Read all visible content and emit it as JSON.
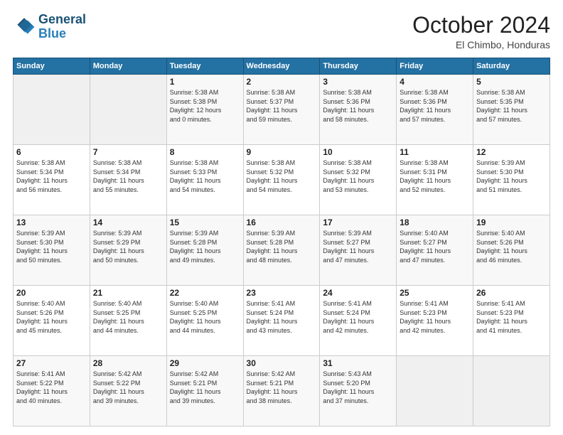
{
  "logo": {
    "line1": "General",
    "line2": "Blue"
  },
  "title": "October 2024",
  "subtitle": "El Chimbo, Honduras",
  "days_header": [
    "Sunday",
    "Monday",
    "Tuesday",
    "Wednesday",
    "Thursday",
    "Friday",
    "Saturday"
  ],
  "weeks": [
    [
      {
        "num": "",
        "info": ""
      },
      {
        "num": "",
        "info": ""
      },
      {
        "num": "1",
        "info": "Sunrise: 5:38 AM\nSunset: 5:38 PM\nDaylight: 12 hours\nand 0 minutes."
      },
      {
        "num": "2",
        "info": "Sunrise: 5:38 AM\nSunset: 5:37 PM\nDaylight: 11 hours\nand 59 minutes."
      },
      {
        "num": "3",
        "info": "Sunrise: 5:38 AM\nSunset: 5:36 PM\nDaylight: 11 hours\nand 58 minutes."
      },
      {
        "num": "4",
        "info": "Sunrise: 5:38 AM\nSunset: 5:36 PM\nDaylight: 11 hours\nand 57 minutes."
      },
      {
        "num": "5",
        "info": "Sunrise: 5:38 AM\nSunset: 5:35 PM\nDaylight: 11 hours\nand 57 minutes."
      }
    ],
    [
      {
        "num": "6",
        "info": "Sunrise: 5:38 AM\nSunset: 5:34 PM\nDaylight: 11 hours\nand 56 minutes."
      },
      {
        "num": "7",
        "info": "Sunrise: 5:38 AM\nSunset: 5:34 PM\nDaylight: 11 hours\nand 55 minutes."
      },
      {
        "num": "8",
        "info": "Sunrise: 5:38 AM\nSunset: 5:33 PM\nDaylight: 11 hours\nand 54 minutes."
      },
      {
        "num": "9",
        "info": "Sunrise: 5:38 AM\nSunset: 5:32 PM\nDaylight: 11 hours\nand 54 minutes."
      },
      {
        "num": "10",
        "info": "Sunrise: 5:38 AM\nSunset: 5:32 PM\nDaylight: 11 hours\nand 53 minutes."
      },
      {
        "num": "11",
        "info": "Sunrise: 5:38 AM\nSunset: 5:31 PM\nDaylight: 11 hours\nand 52 minutes."
      },
      {
        "num": "12",
        "info": "Sunrise: 5:39 AM\nSunset: 5:30 PM\nDaylight: 11 hours\nand 51 minutes."
      }
    ],
    [
      {
        "num": "13",
        "info": "Sunrise: 5:39 AM\nSunset: 5:30 PM\nDaylight: 11 hours\nand 50 minutes."
      },
      {
        "num": "14",
        "info": "Sunrise: 5:39 AM\nSunset: 5:29 PM\nDaylight: 11 hours\nand 50 minutes."
      },
      {
        "num": "15",
        "info": "Sunrise: 5:39 AM\nSunset: 5:28 PM\nDaylight: 11 hours\nand 49 minutes."
      },
      {
        "num": "16",
        "info": "Sunrise: 5:39 AM\nSunset: 5:28 PM\nDaylight: 11 hours\nand 48 minutes."
      },
      {
        "num": "17",
        "info": "Sunrise: 5:39 AM\nSunset: 5:27 PM\nDaylight: 11 hours\nand 47 minutes."
      },
      {
        "num": "18",
        "info": "Sunrise: 5:40 AM\nSunset: 5:27 PM\nDaylight: 11 hours\nand 47 minutes."
      },
      {
        "num": "19",
        "info": "Sunrise: 5:40 AM\nSunset: 5:26 PM\nDaylight: 11 hours\nand 46 minutes."
      }
    ],
    [
      {
        "num": "20",
        "info": "Sunrise: 5:40 AM\nSunset: 5:26 PM\nDaylight: 11 hours\nand 45 minutes."
      },
      {
        "num": "21",
        "info": "Sunrise: 5:40 AM\nSunset: 5:25 PM\nDaylight: 11 hours\nand 44 minutes."
      },
      {
        "num": "22",
        "info": "Sunrise: 5:40 AM\nSunset: 5:25 PM\nDaylight: 11 hours\nand 44 minutes."
      },
      {
        "num": "23",
        "info": "Sunrise: 5:41 AM\nSunset: 5:24 PM\nDaylight: 11 hours\nand 43 minutes."
      },
      {
        "num": "24",
        "info": "Sunrise: 5:41 AM\nSunset: 5:24 PM\nDaylight: 11 hours\nand 42 minutes."
      },
      {
        "num": "25",
        "info": "Sunrise: 5:41 AM\nSunset: 5:23 PM\nDaylight: 11 hours\nand 42 minutes."
      },
      {
        "num": "26",
        "info": "Sunrise: 5:41 AM\nSunset: 5:23 PM\nDaylight: 11 hours\nand 41 minutes."
      }
    ],
    [
      {
        "num": "27",
        "info": "Sunrise: 5:41 AM\nSunset: 5:22 PM\nDaylight: 11 hours\nand 40 minutes."
      },
      {
        "num": "28",
        "info": "Sunrise: 5:42 AM\nSunset: 5:22 PM\nDaylight: 11 hours\nand 39 minutes."
      },
      {
        "num": "29",
        "info": "Sunrise: 5:42 AM\nSunset: 5:21 PM\nDaylight: 11 hours\nand 39 minutes."
      },
      {
        "num": "30",
        "info": "Sunrise: 5:42 AM\nSunset: 5:21 PM\nDaylight: 11 hours\nand 38 minutes."
      },
      {
        "num": "31",
        "info": "Sunrise: 5:43 AM\nSunset: 5:20 PM\nDaylight: 11 hours\nand 37 minutes."
      },
      {
        "num": "",
        "info": ""
      },
      {
        "num": "",
        "info": ""
      }
    ]
  ]
}
